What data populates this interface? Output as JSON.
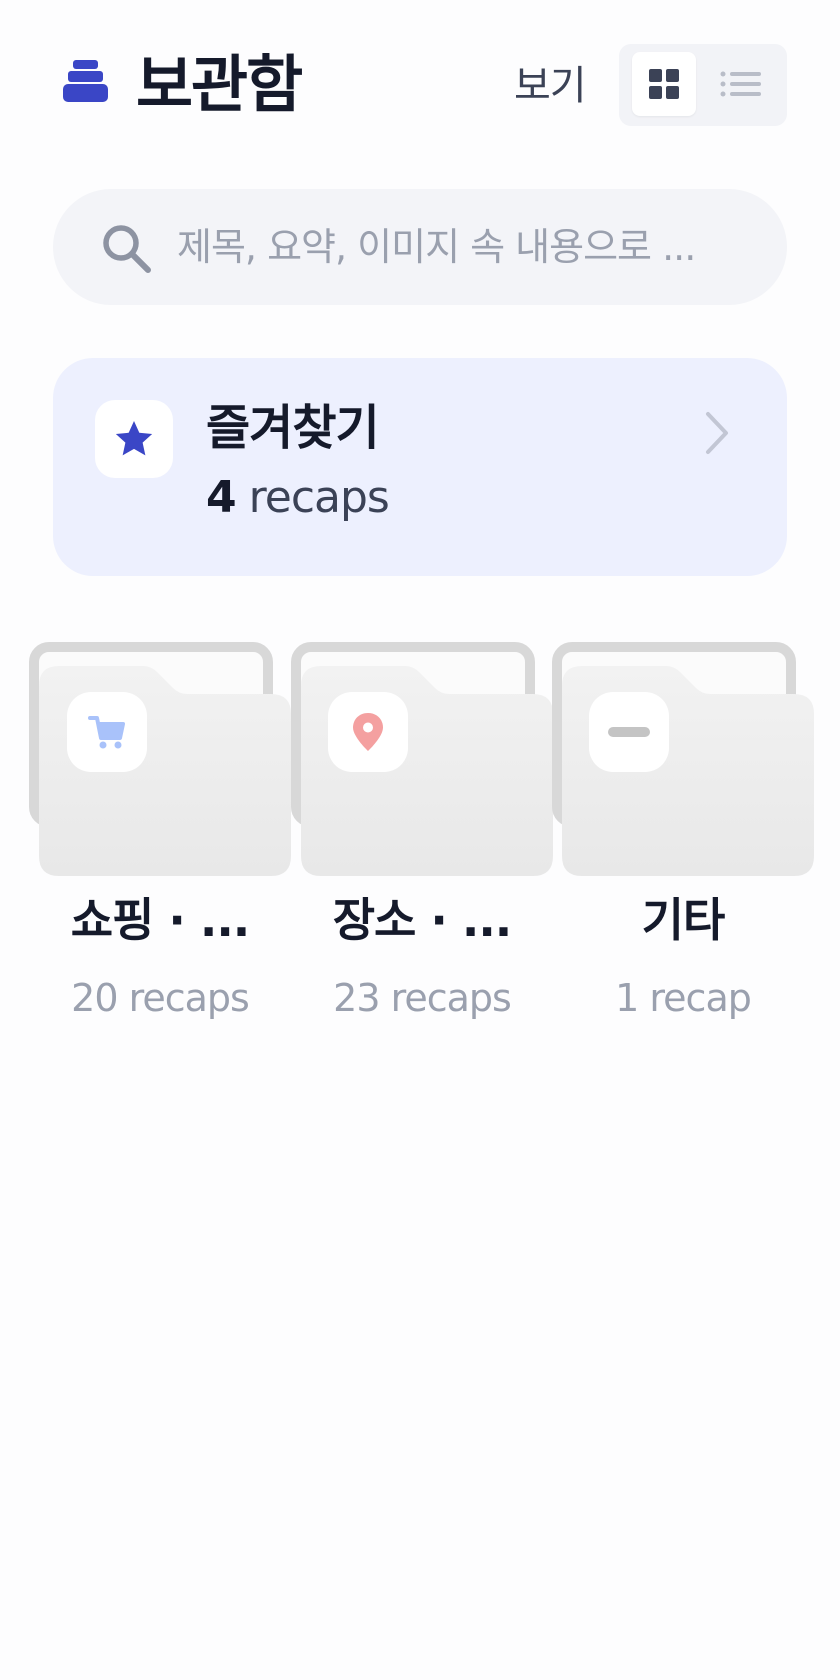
{
  "header": {
    "title": "보관함",
    "view_label": "보기",
    "view_modes": [
      "grid",
      "list"
    ],
    "active_view": "grid",
    "logo_icon": "stacked-boxes-icon"
  },
  "search": {
    "value": "",
    "placeholder": "제목, 요약, 이미지 속 내용으로 ...",
    "icon": "search-icon"
  },
  "favorites": {
    "title": "즐겨찾기",
    "count_number": "4",
    "count_unit": "recaps",
    "icon": "star-icon"
  },
  "folders": [
    {
      "name": "쇼핑 · ...",
      "count": "20 recaps",
      "icon": "shopping-cart-icon"
    },
    {
      "name": "장소 · ...",
      "count": "23 recaps",
      "icon": "map-pin-icon"
    },
    {
      "name": "기타",
      "count": "1 recap",
      "icon": "minus-icon"
    }
  ],
  "colors": {
    "accent": "#3a46c6",
    "favorites_bg": "#edf0fe",
    "cart": "#a9c2fa",
    "pin": "#f4a0a0",
    "minus": "#c4c4c4"
  }
}
